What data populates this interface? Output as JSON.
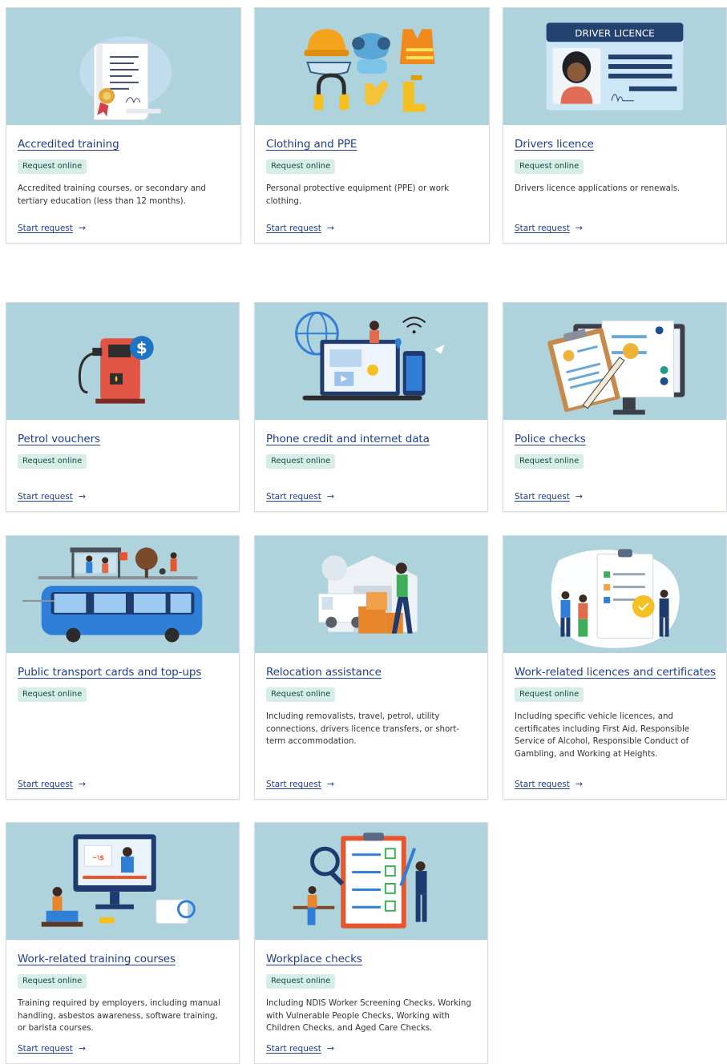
{
  "badge_label": "Request online",
  "start_label": "Start request",
  "arrow_glyph": "→",
  "cards": [
    {
      "title": "Accredited training",
      "desc": "Accredited training courses, or secondary and tertiary education (less than 12 months).",
      "icon": "certificate-scroll-icon"
    },
    {
      "title": "Clothing and PPE",
      "desc": "Personal protective equipment (PPE) or work clothing.",
      "icon": "ppe-gear-icon"
    },
    {
      "title": "Drivers licence",
      "desc": "Drivers licence applications or renewals.",
      "icon": "driver-licence-card-icon",
      "image_text": "DRIVER LICENCE"
    },
    {
      "title": "Petrol vouchers",
      "desc": "",
      "icon": "fuel-pump-icon"
    },
    {
      "title": "Phone credit and internet data",
      "desc": "",
      "icon": "laptop-phone-icon"
    },
    {
      "title": "Police checks",
      "desc": "",
      "icon": "police-check-documents-icon"
    },
    {
      "title": "Public transport cards and top-ups",
      "desc": "",
      "icon": "bus-stop-icon"
    },
    {
      "title": "Relocation assistance",
      "desc": "Including removalists, travel, petrol, utility connections, drivers licence transfers, or short-term accommodation.",
      "icon": "moving-boxes-icon"
    },
    {
      "title": "Work-related licences and certificates",
      "desc": "Including specific vehicle licences, and certificates including First Aid, Responsible Service of Alcohol, Responsible Conduct of Gambling, and Working at Heights.",
      "icon": "certificate-checklist-icon"
    },
    {
      "title": "Work-related training courses",
      "desc": "Training required by employers, including manual handling, asbestos awareness, software training, or barista courses.",
      "icon": "online-training-monitor-icon"
    },
    {
      "title": "Workplace checks",
      "desc": "Including NDIS Worker Screening Checks, Working with Vulnerable People Checks, Working with Children Checks, and Aged Care Checks.",
      "icon": "checklist-clipboard-icon"
    }
  ],
  "colors": {
    "image_bg": "#afd3dc",
    "link": "#1f3e8c",
    "badge_bg": "#d7ede7",
    "badge_text": "#134c43"
  }
}
